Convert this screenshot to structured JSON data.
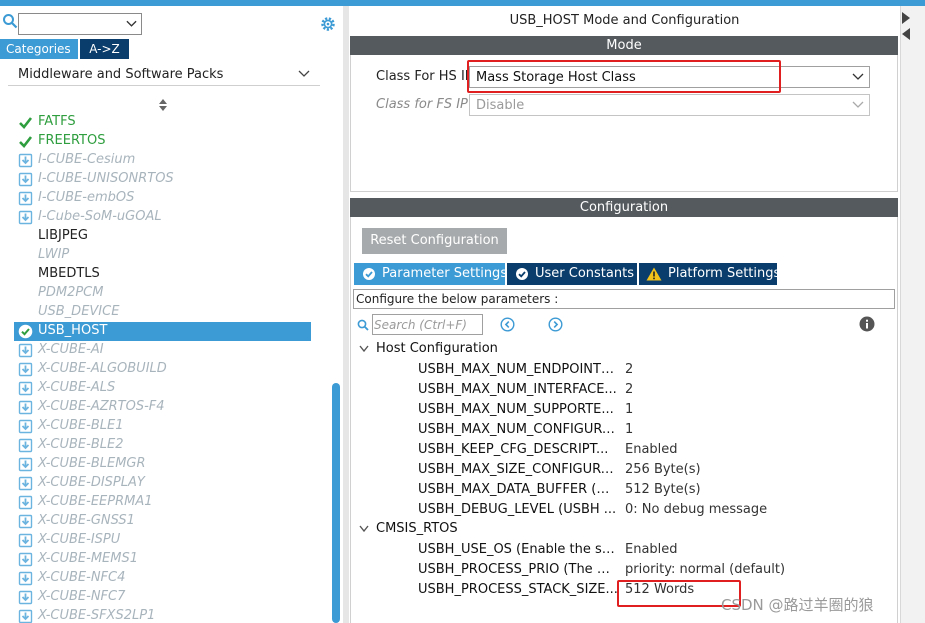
{
  "left_panel": {
    "search_placeholder": "",
    "tabs": {
      "categories": "Categories",
      "az": "A->Z"
    },
    "category_dropdown": "Middleware and Software Packs",
    "items": [
      {
        "label": "FATFS",
        "state": "enabled-check"
      },
      {
        "label": "FREERTOS",
        "state": "enabled-check"
      },
      {
        "label": "I-CUBE-Cesium",
        "state": "download"
      },
      {
        "label": "I-CUBE-UNISONRTOS",
        "state": "download"
      },
      {
        "label": "I-CUBE-embOS",
        "state": "download"
      },
      {
        "label": "I-Cube-SoM-uGOAL",
        "state": "download"
      },
      {
        "label": "LIBJPEG",
        "state": "normal"
      },
      {
        "label": "LWIP",
        "state": "disabled"
      },
      {
        "label": "MBEDTLS",
        "state": "normal"
      },
      {
        "label": "PDM2PCM",
        "state": "disabled"
      },
      {
        "label": "USB_DEVICE",
        "state": "disabled"
      },
      {
        "label": "USB_HOST",
        "state": "selected"
      },
      {
        "label": "X-CUBE-AI",
        "state": "download"
      },
      {
        "label": "X-CUBE-ALGOBUILD",
        "state": "download"
      },
      {
        "label": "X-CUBE-ALS",
        "state": "download"
      },
      {
        "label": "X-CUBE-AZRTOS-F4",
        "state": "download"
      },
      {
        "label": "X-CUBE-BLE1",
        "state": "download"
      },
      {
        "label": "X-CUBE-BLE2",
        "state": "download"
      },
      {
        "label": "X-CUBE-BLEMGR",
        "state": "download"
      },
      {
        "label": "X-CUBE-DISPLAY",
        "state": "download"
      },
      {
        "label": "X-CUBE-EEPRMA1",
        "state": "download"
      },
      {
        "label": "X-CUBE-GNSS1",
        "state": "download"
      },
      {
        "label": "X-CUBE-ISPU",
        "state": "download"
      },
      {
        "label": "X-CUBE-MEMS1",
        "state": "download"
      },
      {
        "label": "X-CUBE-NFC4",
        "state": "download"
      },
      {
        "label": "X-CUBE-NFC7",
        "state": "download"
      },
      {
        "label": "X-CUBE-SFXS2LP1",
        "state": "download"
      }
    ]
  },
  "right_panel": {
    "title": "USB_HOST Mode and Configuration",
    "mode_header": "Mode",
    "hs_label": "Class For HS IP",
    "hs_value": "Mass Storage Host Class",
    "fs_label": "Class for FS IP",
    "fs_value": "Disable",
    "config_header": "Configuration",
    "reset_button": "Reset Configuration",
    "param_tabs": {
      "parameter_settings": "Parameter Settings",
      "user_constants": "User Constants",
      "platform_settings": "Platform Settings"
    },
    "configure_text": "Configure the below parameters :",
    "search_placeholder": "Search (Ctrl+F)",
    "groups": [
      {
        "name": "Host Configuration",
        "params": [
          {
            "name": "USBH_MAX_NUM_ENDPOINTS ...",
            "value": "2"
          },
          {
            "name": "USBH_MAX_NUM_INTERFACE...",
            "value": "2"
          },
          {
            "name": "USBH_MAX_NUM_SUPPORTE...",
            "value": "1"
          },
          {
            "name": "USBH_MAX_NUM_CONFIGURA...",
            "value": "1"
          },
          {
            "name": "USBH_KEEP_CFG_DESCRIPT...",
            "value": "Enabled"
          },
          {
            "name": "USBH_MAX_SIZE_CONFIGURA...",
            "value": "256 Byte(s)"
          },
          {
            "name": "USBH_MAX_DATA_BUFFER (M...",
            "value": "512 Byte(s)"
          },
          {
            "name": "USBH_DEBUG_LEVEL (USBH ...",
            "value": "0: No debug message"
          }
        ]
      },
      {
        "name": "CMSIS_RTOS",
        "params": [
          {
            "name": "USBH_USE_OS (Enable the sup...",
            "value": "Enabled"
          },
          {
            "name": "USBH_PROCESS_PRIO (The C...",
            "value": "priority: normal (default)"
          },
          {
            "name": "USBH_PROCESS_STACK_SIZE...",
            "value": "512 Words"
          }
        ]
      }
    ]
  },
  "watermark": "CSDN @路过羊圈的狼",
  "colors": {
    "accent": "#3c9ad4",
    "dark_tab": "#0a3d6b",
    "header_bar": "#555a5e",
    "enabled_green": "#2e9e3e",
    "highlight_red": "#e02020"
  }
}
